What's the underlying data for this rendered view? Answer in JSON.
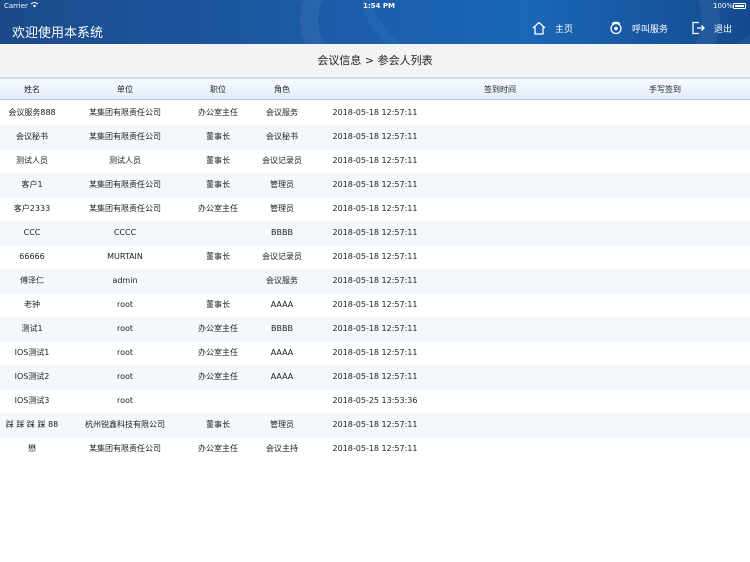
{
  "status_bar": {
    "carrier": "Carrier",
    "time": "1:54 PM",
    "battery": "100%"
  },
  "header": {
    "title": "欢迎使用本系统",
    "nav": {
      "home": "主页",
      "call": "呼叫服务",
      "exit": "退出"
    }
  },
  "page": {
    "breadcrumb": "会议信息 > 参会人列表"
  },
  "table": {
    "columns": [
      "姓名",
      "单位",
      "职位",
      "角色",
      "签到时间",
      "手写签到"
    ],
    "rows": [
      [
        "会议服务888",
        "某集团有限责任公司",
        "办公室主任",
        "会议服务",
        "2018-05-18 12:57:11",
        ""
      ],
      [
        "会议秘书",
        "某集团有限责任公司",
        "董事长",
        "会议秘书",
        "2018-05-18 12:57:11",
        ""
      ],
      [
        "测试人员",
        "测试人员",
        "董事长",
        "会议记录员",
        "2018-05-18 12:57:11",
        ""
      ],
      [
        "客户1",
        "某集团有限责任公司",
        "董事长",
        "管理员",
        "2018-05-18 12:57:11",
        ""
      ],
      [
        "客户2333",
        "某集团有限责任公司",
        "办公室主任",
        "管理员",
        "2018-05-18 12:57:11",
        ""
      ],
      [
        "CCC",
        "CCCC",
        "",
        "BBBB",
        "2018-05-18 12:57:11",
        ""
      ],
      [
        "66666",
        "MURTAIN",
        "董事长",
        "会议记录员",
        "2018-05-18 12:57:11",
        ""
      ],
      [
        "傅泽仁",
        "admin",
        "",
        "会议服务",
        "2018-05-18 12:57:11",
        ""
      ],
      [
        "老钟",
        "root",
        "董事长",
        "AAAA",
        "2018-05-18 12:57:11",
        ""
      ],
      [
        "测试1",
        "root",
        "办公室主任",
        "BBBB",
        "2018-05-18 12:57:11",
        ""
      ],
      [
        "IOS测试1",
        "root",
        "办公室主任",
        "AAAA",
        "2018-05-18 12:57:11",
        ""
      ],
      [
        "IOS测试2",
        "root",
        "办公室主任",
        "AAAA",
        "2018-05-18 12:57:11",
        ""
      ],
      [
        "IOS测试3",
        "root",
        "",
        "",
        "2018-05-25 13:53:36",
        ""
      ],
      [
        "踩 踩 踩 踩 88",
        "杭州锐鑫科技有限公司",
        "董事长",
        "管理员",
        "2018-05-18 12:57:11",
        ""
      ],
      [
        "懋",
        "某集团有限责任公司",
        "办公室主任",
        "会议主持",
        "2018-05-18 12:57:11",
        ""
      ]
    ]
  },
  "icons": {
    "home": "home-icon",
    "call": "service-bell-icon",
    "exit": "logout-icon",
    "wifi": "wifi-icon",
    "battery": "battery-icon"
  },
  "colors": {
    "header_bg": "#1d5aa5",
    "table_head_bg": "#e1eefa",
    "row_alt_bg": "#f4f8fd"
  }
}
